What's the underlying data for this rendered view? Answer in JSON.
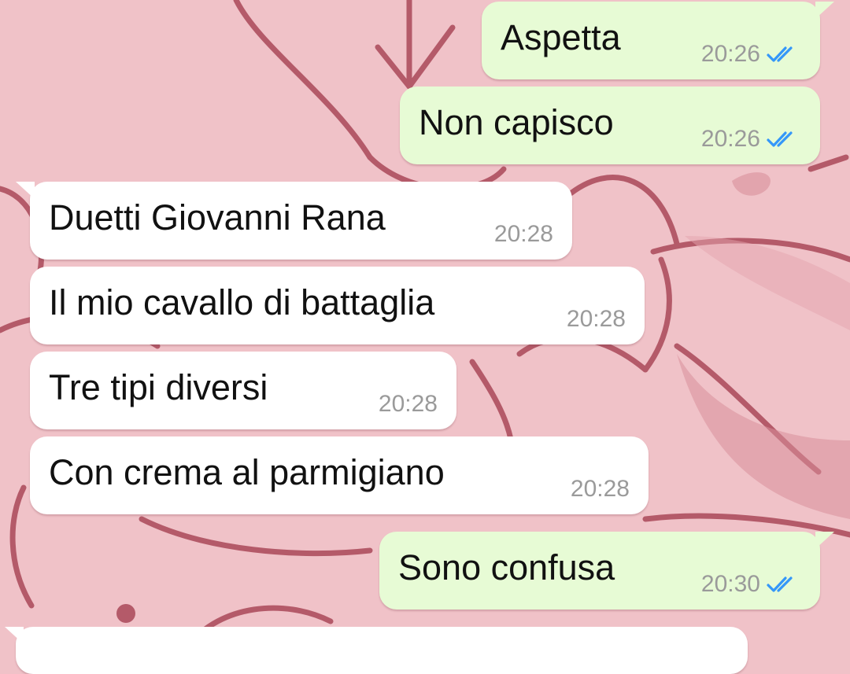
{
  "colors": {
    "wallpaper": "#f0c2c8",
    "wallpaper_lines": "#b45a69",
    "outgoing_bubble": "#e7fbd5",
    "incoming_bubble": "#ffffff",
    "read_ticks": "#3497f9"
  },
  "messages": [
    {
      "direction": "outgoing",
      "text": "Aspetta",
      "time": "20:26",
      "status_icon": "double-check-read-icon"
    },
    {
      "direction": "outgoing",
      "text": "Non capisco",
      "time": "20:26",
      "status_icon": "double-check-read-icon"
    },
    {
      "direction": "incoming",
      "text": "Duetti Giovanni Rana",
      "time": "20:28"
    },
    {
      "direction": "incoming",
      "text": "Il mio cavallo di battaglia",
      "time": "20:28"
    },
    {
      "direction": "incoming",
      "text": "Tre tipi diversi",
      "time": "20:28"
    },
    {
      "direction": "incoming",
      "text": "Con crema al parmigiano",
      "time": "20:28"
    },
    {
      "direction": "outgoing",
      "text": "Sono confusa",
      "time": "20:30",
      "status_icon": "double-check-read-icon"
    }
  ]
}
